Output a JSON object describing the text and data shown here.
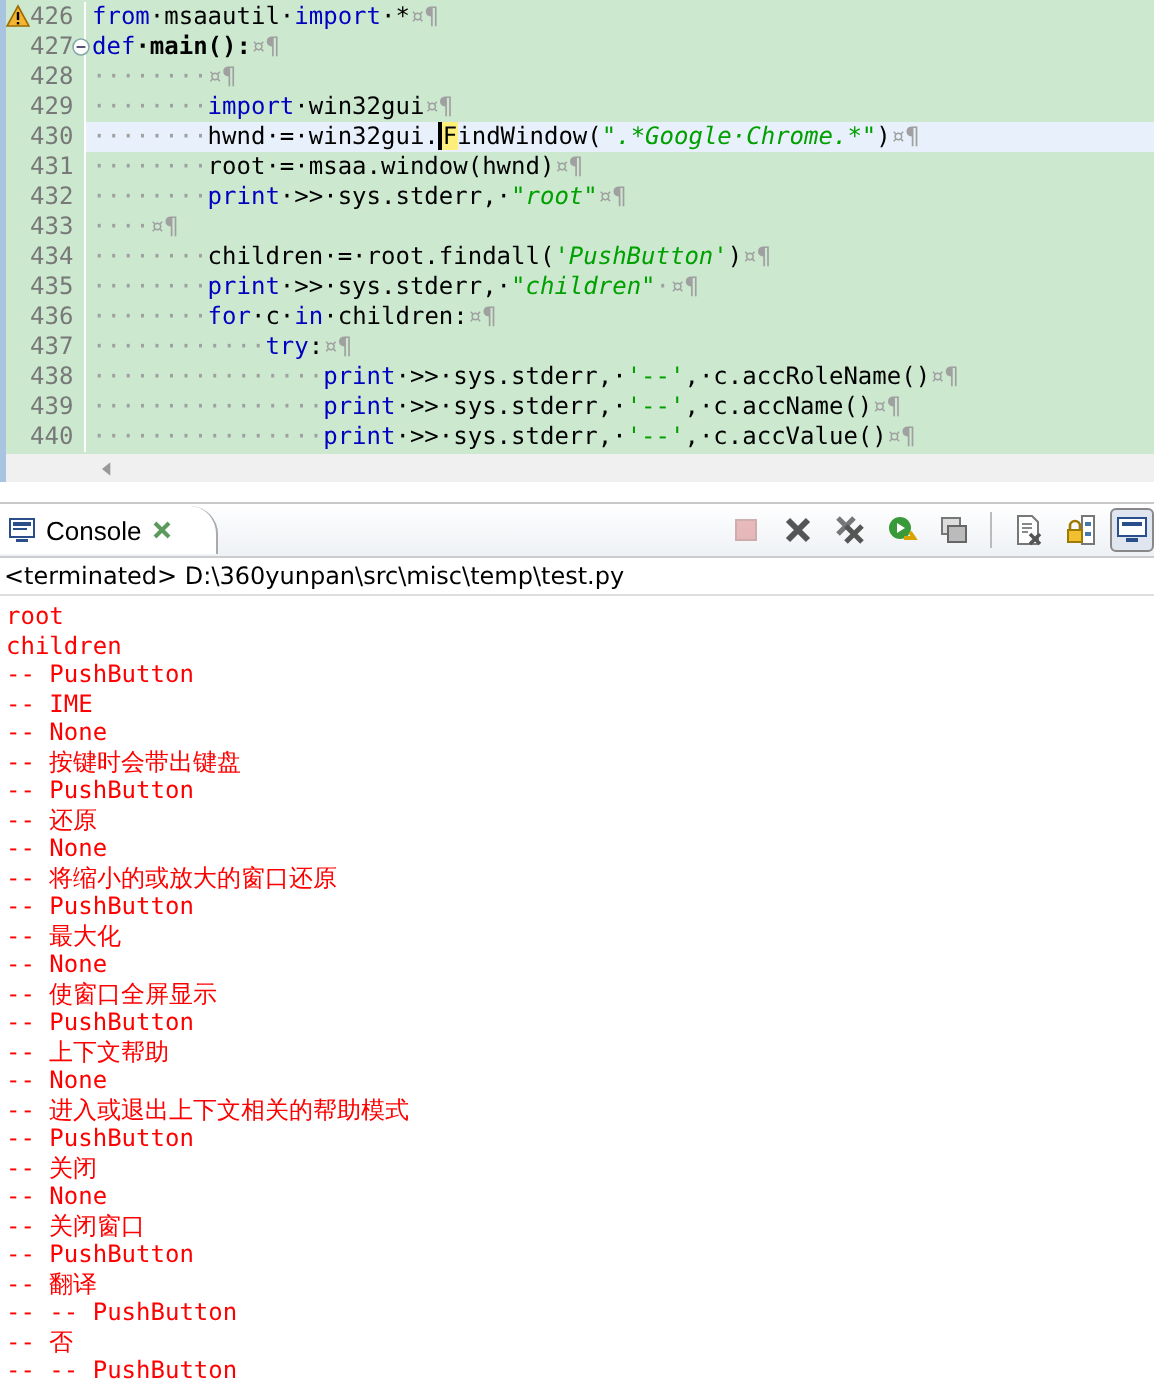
{
  "editor": {
    "lines": [
      {
        "number": "426",
        "warning": true,
        "current": false,
        "tokens": [
          {
            "kind": "kw",
            "text": "from"
          },
          {
            "kind": "plain",
            "text": "·msaautil·"
          },
          {
            "kind": "kw",
            "text": "import"
          },
          {
            "kind": "plain",
            "text": "·*"
          },
          {
            "kind": "ws",
            "text": "¤¶"
          }
        ]
      },
      {
        "number": "427",
        "foldable": true,
        "current": false,
        "tokens": [
          {
            "kind": "kw",
            "text": "def"
          },
          {
            "kind": "fn",
            "text": "·main():"
          },
          {
            "kind": "ws",
            "text": "¤¶"
          }
        ]
      },
      {
        "number": "428",
        "current": false,
        "tokens": [
          {
            "kind": "ws",
            "text": "········¤¶"
          }
        ]
      },
      {
        "number": "429",
        "current": false,
        "tokens": [
          {
            "kind": "ws",
            "text": "········"
          },
          {
            "kind": "kw",
            "text": "import"
          },
          {
            "kind": "plain",
            "text": "·win32gui"
          },
          {
            "kind": "ws",
            "text": "¤¶"
          }
        ]
      },
      {
        "number": "430",
        "current": true,
        "tokens": [
          {
            "kind": "ws",
            "text": "········"
          },
          {
            "kind": "plain",
            "text": "hwnd·=·win32gui."
          },
          {
            "kind": "match",
            "text": "F"
          },
          {
            "kind": "plain",
            "text": "indWindow("
          },
          {
            "kind": "str",
            "text": "\".*Google·Chrome.*\""
          },
          {
            "kind": "plain",
            "text": ")"
          },
          {
            "kind": "ws",
            "text": "¤¶"
          }
        ]
      },
      {
        "number": "431",
        "current": false,
        "tokens": [
          {
            "kind": "ws",
            "text": "········"
          },
          {
            "kind": "plain",
            "text": "root·=·msaa.window(hwnd)"
          },
          {
            "kind": "ws",
            "text": "¤¶"
          }
        ]
      },
      {
        "number": "432",
        "current": false,
        "tokens": [
          {
            "kind": "ws",
            "text": "········"
          },
          {
            "kind": "kw",
            "text": "print"
          },
          {
            "kind": "plain",
            "text": "·>>·sys.stderr,·"
          },
          {
            "kind": "str",
            "text": "\"root\""
          },
          {
            "kind": "ws",
            "text": "¤¶"
          }
        ]
      },
      {
        "number": "433",
        "current": false,
        "tokens": [
          {
            "kind": "ws",
            "text": "····¤¶"
          }
        ]
      },
      {
        "number": "434",
        "current": false,
        "tokens": [
          {
            "kind": "ws",
            "text": "········"
          },
          {
            "kind": "plain",
            "text": "children·=·root.findall("
          },
          {
            "kind": "str",
            "text": "'PushButton'"
          },
          {
            "kind": "plain",
            "text": ")"
          },
          {
            "kind": "ws",
            "text": "¤¶"
          }
        ]
      },
      {
        "number": "435",
        "current": false,
        "tokens": [
          {
            "kind": "ws",
            "text": "········"
          },
          {
            "kind": "kw",
            "text": "print"
          },
          {
            "kind": "plain",
            "text": "·>>·sys.stderr,·"
          },
          {
            "kind": "str",
            "text": "\"children\""
          },
          {
            "kind": "ws",
            "text": "·¤¶"
          }
        ]
      },
      {
        "number": "436",
        "current": false,
        "tokens": [
          {
            "kind": "ws",
            "text": "········"
          },
          {
            "kind": "kw",
            "text": "for"
          },
          {
            "kind": "plain",
            "text": "·c·"
          },
          {
            "kind": "kw",
            "text": "in"
          },
          {
            "kind": "plain",
            "text": "·children:"
          },
          {
            "kind": "ws",
            "text": "¤¶"
          }
        ]
      },
      {
        "number": "437",
        "current": false,
        "tokens": [
          {
            "kind": "ws",
            "text": "············"
          },
          {
            "kind": "kw",
            "text": "try"
          },
          {
            "kind": "plain",
            "text": ":"
          },
          {
            "kind": "ws",
            "text": "¤¶"
          }
        ]
      },
      {
        "number": "438",
        "current": false,
        "tokens": [
          {
            "kind": "ws",
            "text": "················"
          },
          {
            "kind": "kw",
            "text": "print"
          },
          {
            "kind": "plain",
            "text": "·>>·sys.stderr,·"
          },
          {
            "kind": "str2",
            "text": "'--'"
          },
          {
            "kind": "plain",
            "text": ",·c.accRoleName()"
          },
          {
            "kind": "ws",
            "text": "¤¶"
          }
        ]
      },
      {
        "number": "439",
        "current": false,
        "tokens": [
          {
            "kind": "ws",
            "text": "················"
          },
          {
            "kind": "kw",
            "text": "print"
          },
          {
            "kind": "plain",
            "text": "·>>·sys.stderr,·"
          },
          {
            "kind": "str2",
            "text": "'--'"
          },
          {
            "kind": "plain",
            "text": ",·c.accName()"
          },
          {
            "kind": "ws",
            "text": "¤¶"
          }
        ]
      },
      {
        "number": "440",
        "current": false,
        "tokens": [
          {
            "kind": "ws",
            "text": "················"
          },
          {
            "kind": "kw",
            "text": "print"
          },
          {
            "kind": "plain",
            "text": "·>>·sys.stderr,·"
          },
          {
            "kind": "str2",
            "text": "'--'"
          },
          {
            "kind": "plain",
            "text": ",·c.accValue()"
          },
          {
            "kind": "ws",
            "text": "¤¶"
          }
        ]
      }
    ]
  },
  "console": {
    "tab": {
      "label": "Console",
      "selected": true
    },
    "toolbar": [
      {
        "kind": "stop",
        "disabled": true,
        "pressed": false
      },
      {
        "kind": "remove",
        "disabled": false,
        "pressed": false
      },
      {
        "kind": "remove-all",
        "disabled": false,
        "pressed": false
      },
      {
        "kind": "relaunch",
        "disabled": false,
        "pressed": false
      },
      {
        "kind": "windows",
        "disabled": false,
        "pressed": false
      },
      {
        "kind": "clear",
        "disabled": false,
        "pressed": false
      },
      {
        "kind": "lock",
        "disabled": false,
        "pressed": false
      },
      {
        "kind": "display",
        "disabled": false,
        "pressed": true
      }
    ],
    "status": "<terminated> D:\\360yunpan\\src\\misc\\temp\\test.py",
    "output": [
      "root",
      "children",
      "-- PushButton",
      "-- IME",
      "-- None",
      "-- 按键时会带出键盘",
      "-- PushButton",
      "-- 还原",
      "-- None",
      "-- 将缩小的或放大的窗口还原",
      "-- PushButton",
      "-- 最大化",
      "-- None",
      "-- 使窗口全屏显示",
      "-- PushButton",
      "-- 上下文帮助",
      "-- None",
      "-- 进入或退出上下文相关的帮助模式",
      "-- PushButton",
      "-- 关闭",
      "-- None",
      "-- 关闭窗口",
      "-- PushButton",
      "-- 翻译",
      "-- -- PushButton",
      "-- 否",
      "-- -- PushButton"
    ]
  }
}
